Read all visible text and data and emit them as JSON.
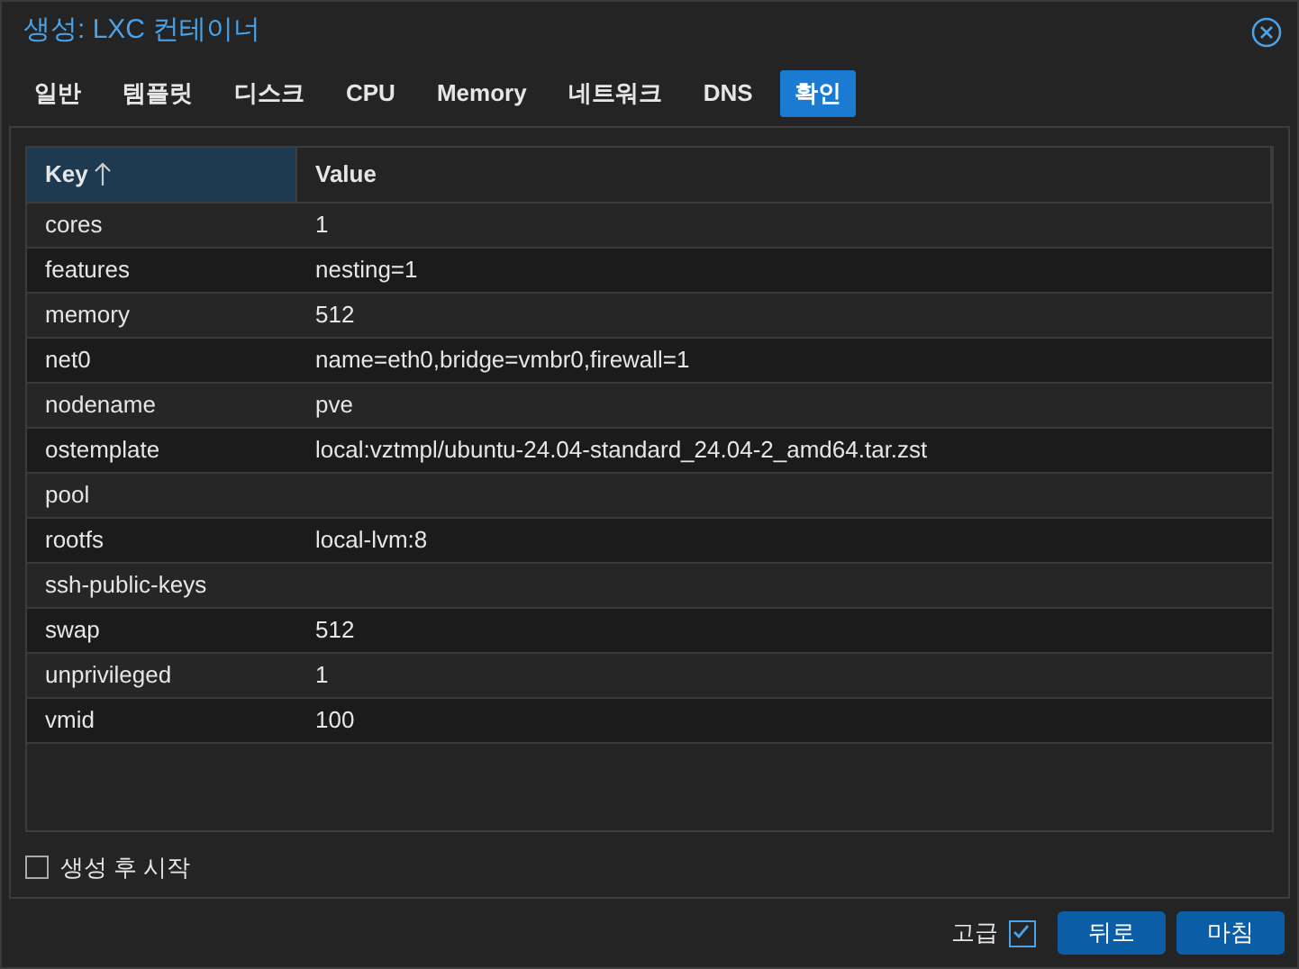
{
  "window": {
    "title": "생성: LXC 컨테이너"
  },
  "tabs": [
    {
      "label": "일반",
      "selected": false
    },
    {
      "label": "템플릿",
      "selected": false
    },
    {
      "label": "디스크",
      "selected": false
    },
    {
      "label": "CPU",
      "selected": false
    },
    {
      "label": "Memory",
      "selected": false
    },
    {
      "label": "네트워크",
      "selected": false
    },
    {
      "label": "DNS",
      "selected": false
    },
    {
      "label": "확인",
      "selected": true
    }
  ],
  "table": {
    "columns": [
      {
        "label": "Key",
        "sorted": true
      },
      {
        "label": "Value",
        "sorted": false
      }
    ],
    "rows": [
      {
        "key": "cores",
        "value": "1"
      },
      {
        "key": "features",
        "value": "nesting=1"
      },
      {
        "key": "memory",
        "value": "512"
      },
      {
        "key": "net0",
        "value": "name=eth0,bridge=vmbr0,firewall=1"
      },
      {
        "key": "nodename",
        "value": "pve"
      },
      {
        "key": "ostemplate",
        "value": "local:vztmpl/ubuntu-24.04-standard_24.04-2_amd64.tar.zst"
      },
      {
        "key": "pool"
      },
      {
        "key": "rootfs",
        "value": "local-lvm:8"
      },
      {
        "key": "ssh-public-keys"
      },
      {
        "key": "swap",
        "value": "512"
      },
      {
        "key": "unprivileged",
        "value": "1"
      },
      {
        "key": "vmid",
        "value": "100"
      }
    ]
  },
  "start_after_create": {
    "label": "생성 후 시작",
    "checked": false
  },
  "advanced": {
    "label": "고급",
    "checked": true
  },
  "buttons": [
    {
      "label": "뒤로"
    },
    {
      "label": "마침"
    }
  ]
}
